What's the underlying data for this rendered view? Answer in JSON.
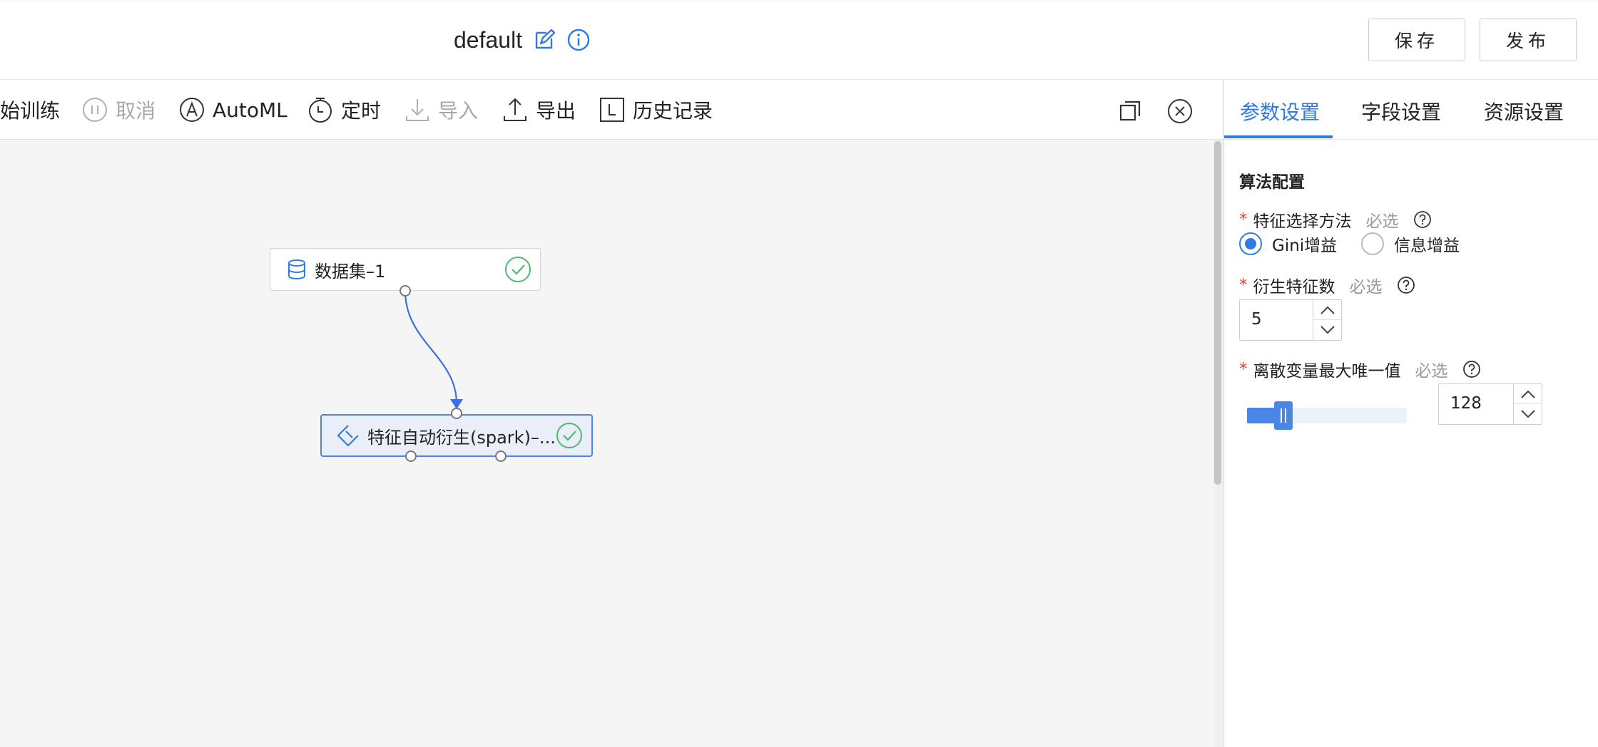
{
  "header": {
    "title": "default",
    "save_label": "保存",
    "publish_label": "发布"
  },
  "toolbar": {
    "items": [
      {
        "label": "始训练",
        "icon": "play-icon",
        "disabled": false
      },
      {
        "label": "取消",
        "icon": "pause-circle-icon",
        "disabled": true
      },
      {
        "label": "AutoML",
        "icon": "automl-icon",
        "disabled": false
      },
      {
        "label": "定时",
        "icon": "timer-icon",
        "disabled": false
      },
      {
        "label": "导入",
        "icon": "import-icon",
        "disabled": true
      },
      {
        "label": "导出",
        "icon": "export-icon",
        "disabled": false
      },
      {
        "label": "历史记录",
        "icon": "history-icon",
        "disabled": false
      }
    ]
  },
  "canvas": {
    "nodes": [
      {
        "label": "数据集–1",
        "icon": "database-icon",
        "status": "success"
      },
      {
        "label": "特征自动衍生(spark)–...",
        "icon": "feature-icon",
        "status": "success"
      }
    ]
  },
  "panel": {
    "tabs": [
      {
        "label": "参数设置",
        "active": true
      },
      {
        "label": "字段设置",
        "active": false
      },
      {
        "label": "资源设置",
        "active": false
      }
    ],
    "section_title": "算法配置",
    "required_mark": "*",
    "optional_text": "必选",
    "feature_method": {
      "label": "特征选择方法",
      "options": [
        {
          "label": "Gini增益",
          "selected": true
        },
        {
          "label": "信息增益",
          "selected": false
        }
      ]
    },
    "derived_count": {
      "label": "衍生特征数",
      "value": "5"
    },
    "max_unique": {
      "label": "离散变量最大唯一值",
      "value": "128"
    }
  },
  "colors": {
    "accent": "#2f7be5",
    "success": "#4cbb6c",
    "required": "#e0453a"
  }
}
